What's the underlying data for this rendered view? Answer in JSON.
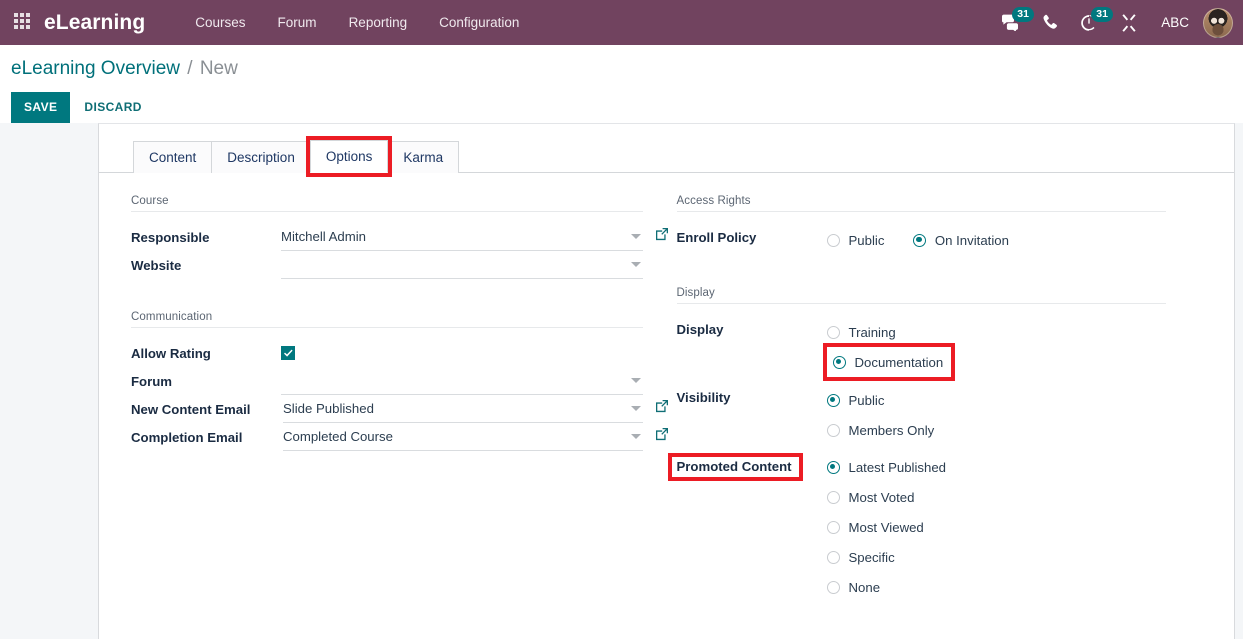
{
  "topbar": {
    "apps_icon": "apps-grid-icon",
    "brand": "eLearning",
    "menu": [
      {
        "label": "Courses"
      },
      {
        "label": "Forum"
      },
      {
        "label": "Reporting"
      },
      {
        "label": "Configuration"
      }
    ],
    "systray": {
      "messages": {
        "icon": "chat-bubble-icon",
        "badge": "31"
      },
      "voip": {
        "icon": "phone-icon",
        "badge": ""
      },
      "activities": {
        "icon": "clock-icon",
        "badge": "31"
      },
      "debug": {
        "icon": "tools-icon",
        "badge": ""
      },
      "user": {
        "name": "ABC",
        "avatar": "user-avatar"
      }
    },
    "accent_color": "#71435f",
    "badge_color": "#00787f"
  },
  "control_panel": {
    "breadcrumb": {
      "root": "eLearning Overview",
      "separator": "/",
      "current": "New"
    },
    "save_label": "SAVE",
    "discard_label": "DISCARD",
    "primary_color": "#00787f"
  },
  "notebook": {
    "tabs": [
      {
        "label": "Content",
        "active": false,
        "highlighted": false
      },
      {
        "label": "Description",
        "active": false,
        "highlighted": false
      },
      {
        "label": "Options",
        "active": true,
        "highlighted": true
      },
      {
        "label": "Karma",
        "active": false,
        "highlighted": false
      }
    ]
  },
  "options_tab": {
    "left": {
      "course_group": {
        "title": "Course",
        "fields": [
          {
            "label": "Responsible",
            "value": "Mitchell Admin",
            "placeholder": "",
            "has_dropdown": true,
            "has_external_link": true
          },
          {
            "label": "Website",
            "value": "",
            "placeholder": "",
            "has_dropdown": true,
            "has_external_link": false
          }
        ]
      },
      "communication_group": {
        "title": "Communication",
        "allow_rating": {
          "label": "Allow Rating",
          "checked": true
        },
        "fields": [
          {
            "label": "Forum",
            "value": "",
            "placeholder": "",
            "has_dropdown": true,
            "has_external_link": false
          },
          {
            "label": "New Content Email",
            "value": "Slide Published",
            "placeholder": "",
            "has_dropdown": true,
            "has_external_link": true
          },
          {
            "label": "Completion Email",
            "value": "Completed Course",
            "placeholder": "",
            "has_dropdown": true,
            "has_external_link": true
          }
        ]
      }
    },
    "right": {
      "access_rights_group": {
        "title": "Access Rights",
        "enroll_policy": {
          "label": "Enroll Policy",
          "options": [
            {
              "label": "Public",
              "selected": false
            },
            {
              "label": "On Invitation",
              "selected": true
            }
          ]
        }
      },
      "display_group": {
        "title": "Display",
        "display": {
          "label": "Display",
          "options": [
            {
              "label": "Training",
              "selected": false,
              "highlighted": false
            },
            {
              "label": "Documentation",
              "selected": true,
              "highlighted": true
            }
          ]
        },
        "visibility": {
          "label": "Visibility",
          "options": [
            {
              "label": "Public",
              "selected": true
            },
            {
              "label": "Members Only",
              "selected": false
            }
          ]
        },
        "promoted_content": {
          "label": "Promoted Content",
          "label_highlighted": true,
          "options": [
            {
              "label": "Latest Published",
              "selected": true
            },
            {
              "label": "Most Voted",
              "selected": false
            },
            {
              "label": "Most Viewed",
              "selected": false
            },
            {
              "label": "Specific",
              "selected": false
            },
            {
              "label": "None",
              "selected": false
            }
          ]
        }
      }
    }
  },
  "highlight_color": "#ec1c24"
}
